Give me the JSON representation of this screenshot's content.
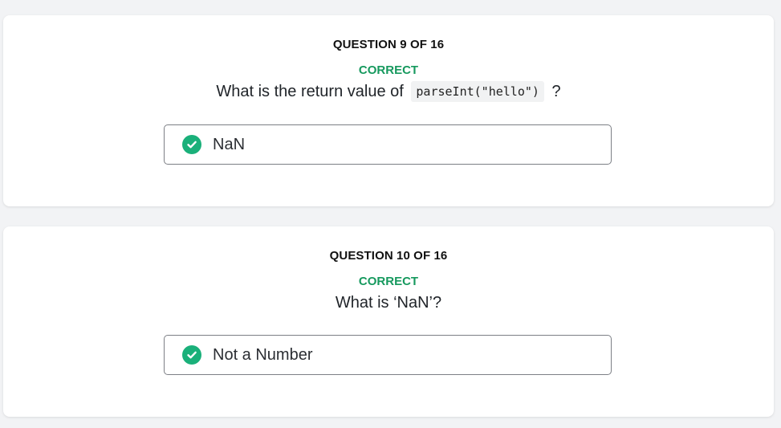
{
  "colors": {
    "page_bg": "#f2f3f5",
    "card_bg": "#ffffff",
    "correct_text": "#16995e",
    "check_fill": "#1ab07a",
    "answer_border": "#7c7f85"
  },
  "questions": [
    {
      "counter": "QUESTION 9 OF 16",
      "status": "CORRECT",
      "text_before": "What is the return value of",
      "code": "parseInt(\"hello\")",
      "text_after": "?",
      "answer": {
        "icon": "check-circle-icon",
        "label": "NaN"
      }
    },
    {
      "counter": "QUESTION 10 OF 16",
      "status": "CORRECT",
      "text": "What is ‘NaN’?",
      "answer": {
        "icon": "check-circle-icon",
        "label": "Not a Number"
      }
    }
  ]
}
